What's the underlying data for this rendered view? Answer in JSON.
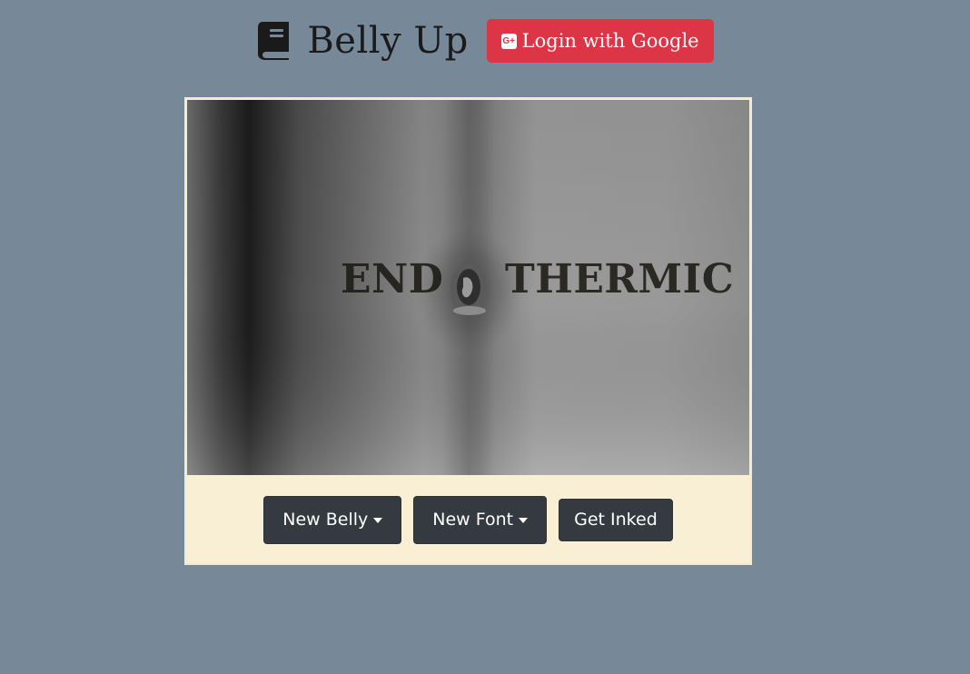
{
  "header": {
    "title": "Belly Up",
    "book_icon": "book-icon",
    "login_label": "Login with Google",
    "login_icon": "google-plus-icon",
    "login_icon_glyph": "G+"
  },
  "card": {
    "tattoo": {
      "left": "END",
      "right": "THERMIC"
    },
    "buttons": {
      "new_belly": "New Belly",
      "new_font": "New Font",
      "get_inked": "Get Inked"
    }
  },
  "colors": {
    "background": "#778899",
    "login_button": "#dc3545",
    "card_background": "#f8efd5",
    "dark_button": "#343a40"
  }
}
